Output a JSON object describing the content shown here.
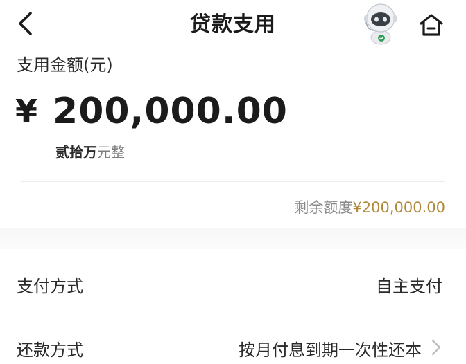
{
  "header": {
    "title": "贷款支用",
    "back_icon": "chevron-left-icon",
    "assistant_icon": "robot-assistant-icon",
    "home_icon": "home-icon"
  },
  "amount": {
    "label": "支用金额(元)",
    "currency_symbol": "¥",
    "value": "200,000.00",
    "words_strong": "贰拾万",
    "words_light": "元整"
  },
  "remaining": {
    "label": "剩余额度",
    "value": "¥200,000.00",
    "value_color": "#b08a3a"
  },
  "rows": [
    {
      "label": "支付方式",
      "value": "自主支付"
    },
    {
      "label": "还款方式",
      "value": "按月付息到期一次性还本",
      "icon": "chevron-right-icon"
    }
  ]
}
